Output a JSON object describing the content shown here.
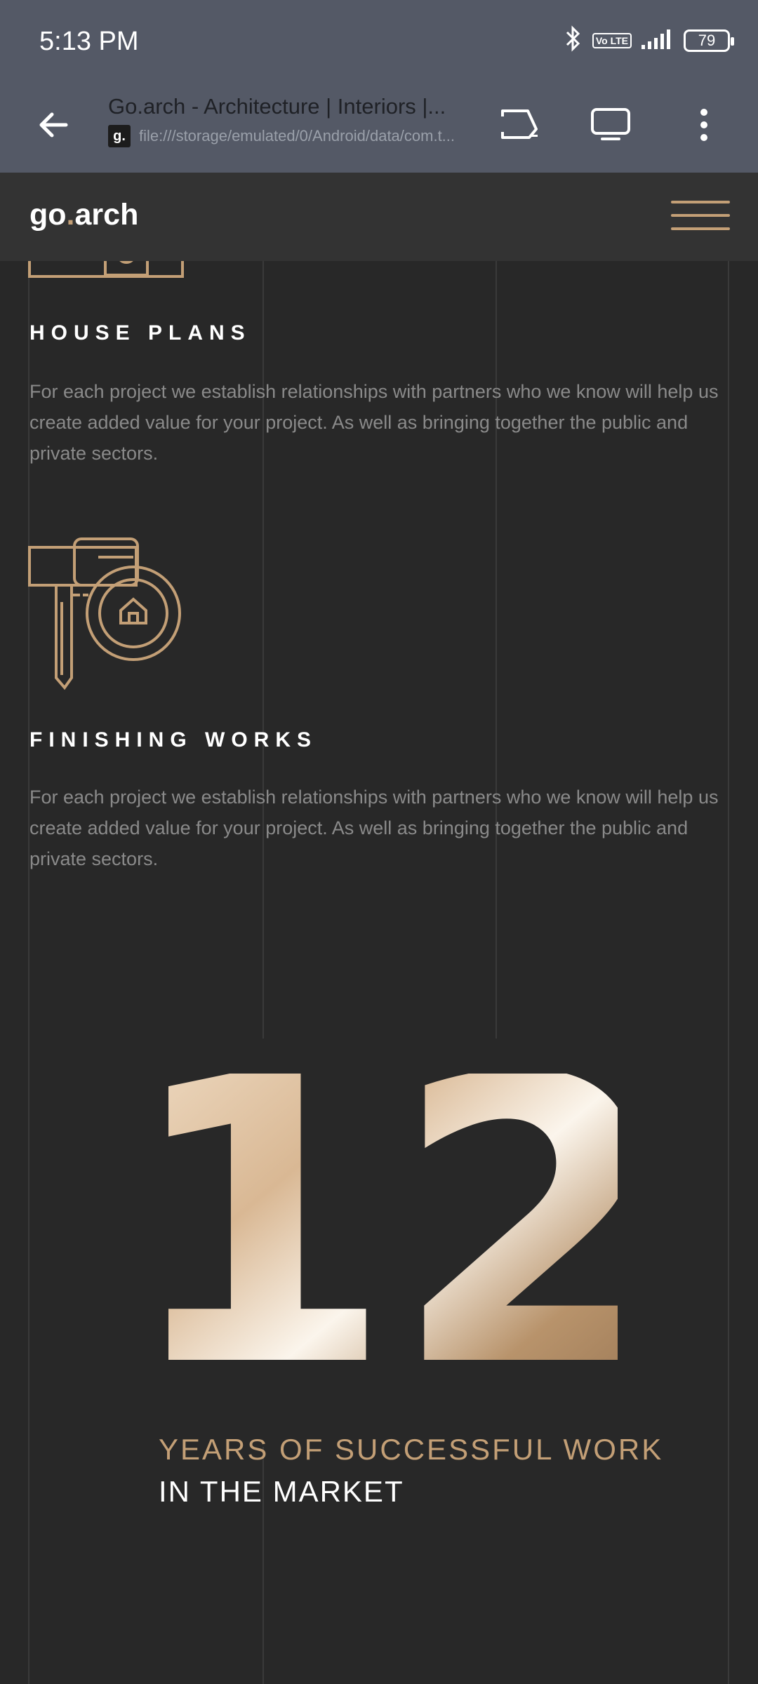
{
  "status_bar": {
    "time": "5:13 PM",
    "lte_label": "Vo LTE",
    "battery": "79",
    "icons": [
      "bluetooth-icon",
      "volte-icon",
      "signal-icon",
      "battery-icon"
    ]
  },
  "browser": {
    "title": "Go.arch - Architecture | Interiors |...",
    "favicon": "g.",
    "url": "file:///storage/emulated/0/Android/data/com.t...",
    "icons": [
      "back-arrow-icon",
      "cast-icon",
      "screen-icon",
      "more-vert-icon"
    ]
  },
  "site": {
    "logo_main": "go",
    "logo_dot": ".",
    "logo_end": "arch",
    "menu_icon": "hamburger-menu-icon"
  },
  "services": [
    {
      "heading": "HOUSE PLANS",
      "text": "For each project we establish relationships with partners who we know will help us create added value for your project. As well as bringing together the public and private sectors."
    },
    {
      "heading": "FINISHING WORKS",
      "text": "For each project we establish relationships with partners who we know will help us create added value for your project. As well as bringing together the public and private sectors."
    }
  ],
  "stats": {
    "number": "12",
    "line1": "YEARS OF SUCCESSFUL WORK",
    "line2": "IN THE MARKET"
  },
  "colors": {
    "accent": "#c39f76",
    "background": "#282828",
    "header": "#333333",
    "browser_chrome": "#545966"
  }
}
